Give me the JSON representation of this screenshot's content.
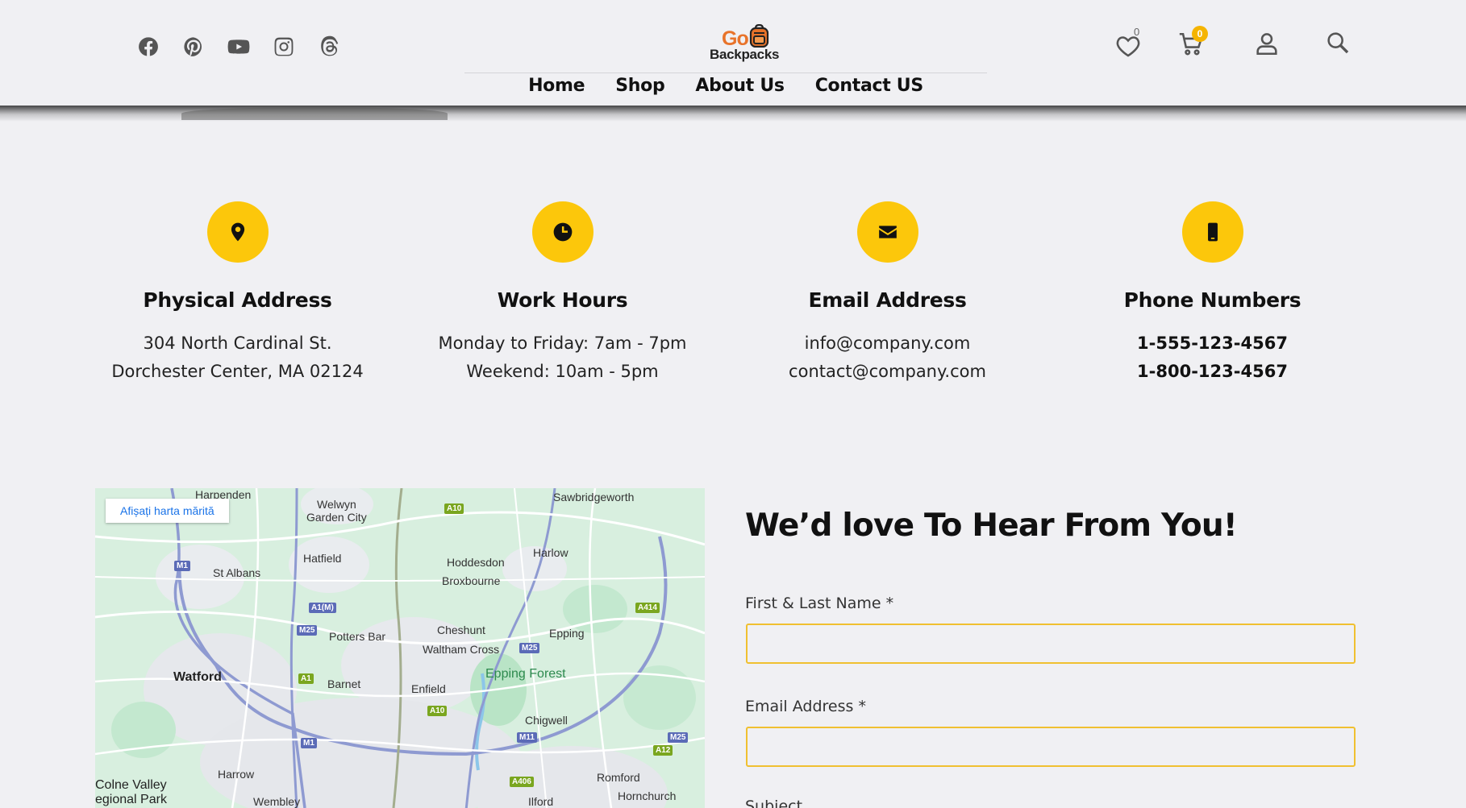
{
  "header": {
    "social": [
      "facebook-icon",
      "pinterest-icon",
      "youtube-icon",
      "instagram-icon",
      "threads-icon"
    ],
    "logo": {
      "word1": "Go",
      "word2": "Backpacks"
    },
    "nav": [
      "Home",
      "Shop",
      "About Us",
      "Contact US"
    ],
    "wishlist_count": "0",
    "cart_count": "0"
  },
  "info": [
    {
      "icon": "map-pin-icon",
      "title": "Physical Address",
      "lines": [
        "304 North Cardinal St.",
        "Dorchester Center, MA 02124"
      ]
    },
    {
      "icon": "clock-icon",
      "title": "Work Hours",
      "lines": [
        "Monday to Friday: 7am - 7pm",
        "Weekend: 10am - 5pm"
      ]
    },
    {
      "icon": "envelope-icon",
      "title": "Email Address",
      "lines": [
        "info@company.com",
        "contact@company.com"
      ]
    },
    {
      "icon": "phone-icon",
      "title": "Phone Numbers",
      "lines": [
        "1-555-123-4567",
        "1-800-123-4567"
      ]
    }
  ],
  "map": {
    "button": "Afișați harta mărită",
    "places": {
      "harpenden": "Harpenden",
      "welwyn": "Welwyn",
      "garden_city": "Garden City",
      "sawbridgeworth": "Sawbridgeworth",
      "hatfield": "Hatfield",
      "st_albans": "St Albans",
      "hoddesdon": "Hoddesdon",
      "broxbourne": "Broxbourne",
      "harlow": "Harlow",
      "potters_bar": "Potters Bar",
      "cheshunt": "Cheshunt",
      "waltham_cross": "Waltham Cross",
      "epping": "Epping",
      "epping_forest": "Epping Forest",
      "watford": "Watford",
      "barnet": "Barnet",
      "enfield": "Enfield",
      "chigwell": "Chigwell",
      "harrow": "Harrow",
      "romford": "Romford",
      "hornchurch": "Hornchurch",
      "colne_valley": "Colne Valley",
      "regional_park": "egional Park",
      "wembley": "Wembley",
      "ilford": "Ilford"
    },
    "roads": {
      "a10_top": "A10",
      "m1_top": "M1",
      "a1m": "A1(M)",
      "a414": "A414",
      "m25_left": "M25",
      "m25_mid": "M25",
      "a1": "A1",
      "a10_mid": "A10",
      "m11": "M11",
      "m1_bottom": "M1",
      "m25_right": "M25",
      "a12": "A12",
      "a406": "A406"
    }
  },
  "form": {
    "title": "We’d love To Hear From You!",
    "name_label": "First & Last Name *",
    "email_label": "Email Address *",
    "subject_label": "Subiect"
  }
}
